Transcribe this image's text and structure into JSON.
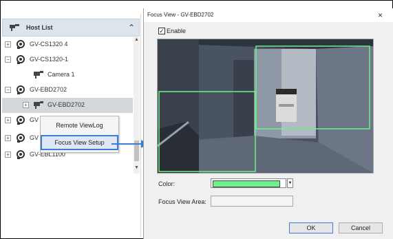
{
  "host_list": {
    "title": "Host List",
    "items": [
      {
        "label": "GV-CS1320 4"
      },
      {
        "label": "GV-CS1320-1"
      },
      {
        "label": "Camera 1"
      },
      {
        "label": "GV-EBD2702"
      },
      {
        "label": "GV-EBD2702"
      },
      {
        "label": "GV"
      },
      {
        "label": "GV"
      },
      {
        "label": "GV-EBL1100"
      }
    ]
  },
  "context_menu": {
    "items": [
      {
        "label": "Remote ViewLog"
      },
      {
        "label": "Focus View Setup"
      }
    ]
  },
  "dialog": {
    "title": "Focus View - GV-EBD2702",
    "close": "×",
    "enable_label": "Enable",
    "enable_checked": "✓",
    "color_label": "Color:",
    "color_value": "#6ef08b",
    "focus_area_label": "Focus View Area:",
    "focus_area_value": "",
    "ok_label": "OK",
    "cancel_label": "Cancel"
  },
  "colors": {
    "accent": "#3a7bd5",
    "focus_line": "#6ef08b"
  }
}
